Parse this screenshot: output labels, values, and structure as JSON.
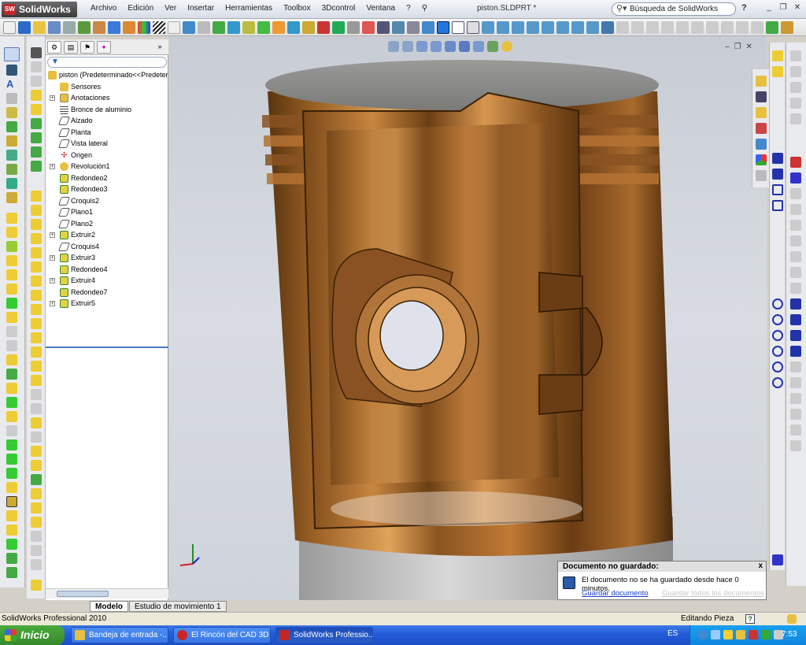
{
  "app": {
    "brand": "SolidWorks",
    "brand_icon": "SW",
    "menu": [
      "Archivo",
      "Edición",
      "Ver",
      "Insertar",
      "Herramientas",
      "Toolbox",
      "3Dcontrol",
      "Ventana",
      "?"
    ],
    "document_title": "piston.SLDPRT *",
    "search_placeholder": "Búsqueda de SolidWorks",
    "help_label": "?"
  },
  "feature_tree": {
    "tabs": [
      "feature-manager",
      "property-manager",
      "configuration-manager",
      "dimxpert-manager"
    ],
    "items": [
      {
        "label": "piston  (Predeterminado<<Predeter",
        "icon": "part-icon",
        "root": true,
        "expandable": false
      },
      {
        "label": "Sensores",
        "icon": "sensor-icon",
        "expandable": false
      },
      {
        "label": "Anotaciones",
        "icon": "annotation-icon",
        "expandable": true
      },
      {
        "label": "Bronce de aluminio",
        "icon": "material-icon",
        "expandable": false
      },
      {
        "label": "Alzado",
        "icon": "plane-icon",
        "expandable": false
      },
      {
        "label": "Planta",
        "icon": "plane-icon",
        "expandable": false
      },
      {
        "label": "Vista lateral",
        "icon": "plane-icon",
        "expandable": false
      },
      {
        "label": "Origen",
        "icon": "origin-icon",
        "expandable": false
      },
      {
        "label": "Revolución1",
        "icon": "revolve-icon",
        "expandable": true
      },
      {
        "label": "Redondeo2",
        "icon": "fillet-icon",
        "expandable": false
      },
      {
        "label": "Redondeo3",
        "icon": "fillet-icon",
        "expandable": false
      },
      {
        "label": "Croquis2",
        "icon": "sketch-icon",
        "expandable": false
      },
      {
        "label": "Plano1",
        "icon": "plane-icon",
        "expandable": false
      },
      {
        "label": "Plano2",
        "icon": "plane-icon",
        "expandable": false
      },
      {
        "label": "Extruir2",
        "icon": "extrude-icon",
        "expandable": true
      },
      {
        "label": "Croquis4",
        "icon": "sketch-icon",
        "expandable": false
      },
      {
        "label": "Extruir3",
        "icon": "extrude-icon",
        "expandable": true
      },
      {
        "label": "Redondeo4",
        "icon": "fillet-icon",
        "expandable": false
      },
      {
        "label": "Extruir4",
        "icon": "extrude-icon",
        "expandable": true
      },
      {
        "label": "Redondeo7",
        "icon": "fillet-icon",
        "expandable": false
      },
      {
        "label": "Extruir5",
        "icon": "extrude-icon",
        "expandable": true
      }
    ],
    "bottom_tabs": [
      "Modelo",
      "Estudio de movimiento 1"
    ]
  },
  "notification": {
    "title": "Documento no guardado:",
    "message": "El documento no se ha guardado desde hace 0 minutos.",
    "save_link": "Guardar documento",
    "save_all_link": "Guardar todos los documentos",
    "close_label": "x"
  },
  "statusbar": {
    "left": "SolidWorks Professional 2010",
    "mode": "Editando Pieza",
    "help_label": "?"
  },
  "taskbar": {
    "start_label": "Inicio",
    "tasks": [
      "Bandeja de entrada -...",
      "El Rincón del CAD 3D ...",
      "SolidWorks Professio..."
    ],
    "language": "ES",
    "clock": "7:53"
  },
  "colors": {
    "accent": "#245edb",
    "bronze": "#b8732e",
    "tree_selection": "#4a78c8"
  }
}
